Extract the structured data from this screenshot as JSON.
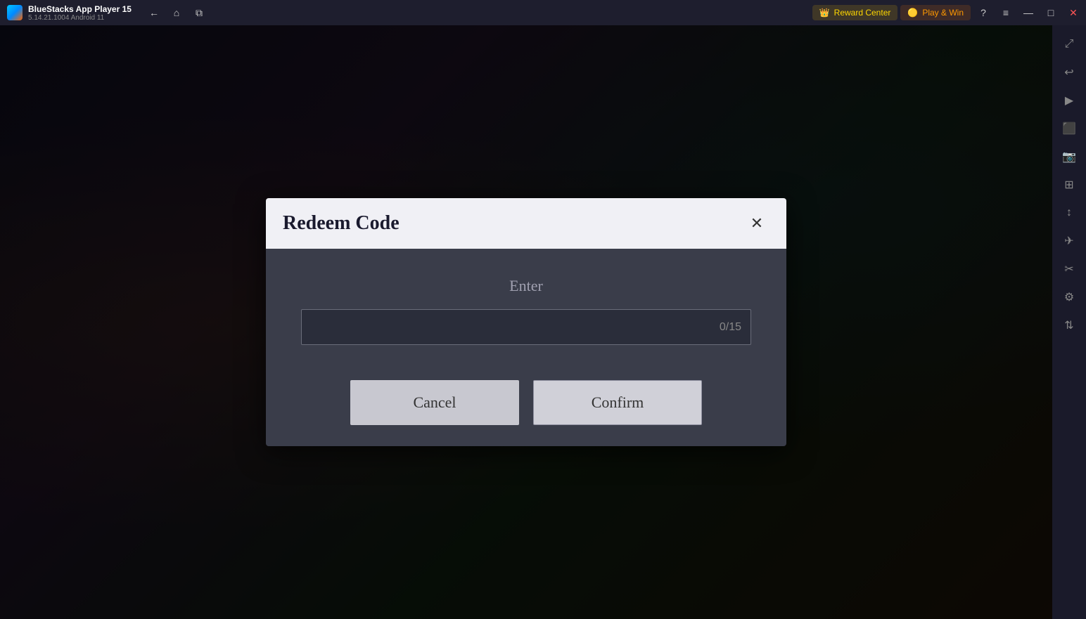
{
  "titlebar": {
    "logo_alt": "bluestacks-logo",
    "app_name": "BlueStacks App Player 15",
    "app_version": "5.14.21.1004  Android 11",
    "nav_buttons": [
      {
        "label": "←",
        "name": "back-nav"
      },
      {
        "label": "⌂",
        "name": "home-nav"
      },
      {
        "label": "⧉",
        "name": "overview-nav"
      }
    ],
    "reward_center_label": "Reward Center",
    "play_win_label": "Play & Win",
    "help_label": "?",
    "menu_label": "≡",
    "minimize_label": "—",
    "maximize_label": "□",
    "close_label": "✕",
    "expand_label": "⤢"
  },
  "sidebar": {
    "buttons": [
      {
        "icon": "⤢",
        "name": "fullscreen-icon"
      },
      {
        "icon": "↩",
        "name": "rotate-icon"
      },
      {
        "icon": "▶",
        "name": "play-icon"
      },
      {
        "icon": "⬛",
        "name": "screen-icon"
      },
      {
        "icon": "📷",
        "name": "screenshot-icon"
      },
      {
        "icon": "⊞",
        "name": "multiinstance-icon"
      },
      {
        "icon": "↕",
        "name": "resize-icon"
      },
      {
        "icon": "✈",
        "name": "location-icon"
      },
      {
        "icon": "✂",
        "name": "macro-icon"
      },
      {
        "icon": "⚙",
        "name": "settings-icon"
      },
      {
        "icon": "↕",
        "name": "scroll-icon"
      }
    ]
  },
  "modal": {
    "title": "Redeem Code",
    "close_label": "✕",
    "enter_label": "Enter",
    "input_placeholder": "",
    "input_counter": "0/15",
    "cancel_label": "Cancel",
    "confirm_label": "Confirm"
  }
}
